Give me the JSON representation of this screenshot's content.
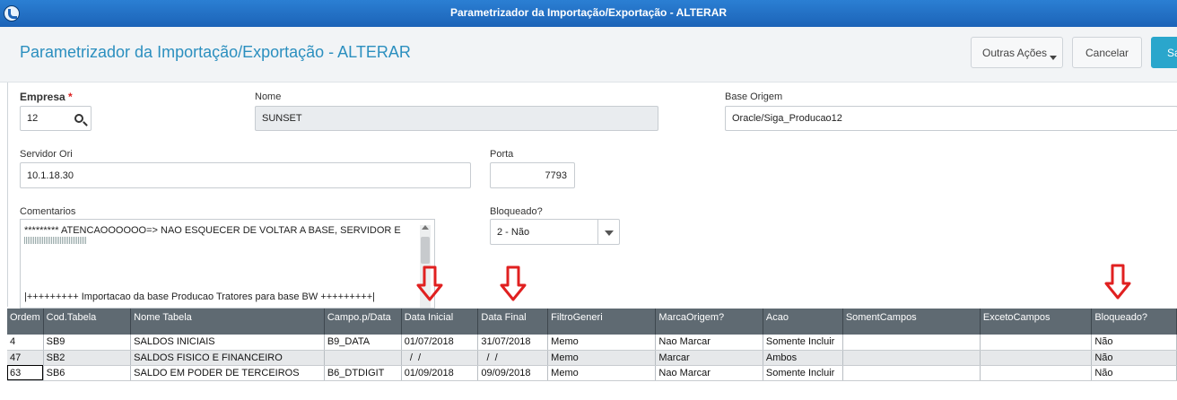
{
  "window": {
    "title": "Parametrizador da Importação/Exportação - ALTERAR"
  },
  "header": {
    "page_title": "Parametrizador da Importação/Exportação - ALTERAR",
    "outras_acoes_label": "Outras Ações",
    "cancelar_label": "Cancelar",
    "salvar_label": "Sa"
  },
  "form": {
    "empresa": {
      "label": "Empresa",
      "required_mark": "*",
      "value": "12"
    },
    "nome": {
      "label": "Nome",
      "value": "SUNSET"
    },
    "base_origem": {
      "label": "Base Origem",
      "value": "Oracle/Siga_Producao12"
    },
    "servidor_ori": {
      "label": "Servidor Ori",
      "value": "10.1.18.30"
    },
    "porta": {
      "label": "Porta",
      "value": "7793"
    },
    "comentarios": {
      "label": "Comentarios",
      "line1": "********* ATENCAOOOOOO=> NAO ESQUECER DE VOLTAR A BASE, SERVIDOR E PORTA",
      "line3": "|+++++++++  Importacao da base Producao Tratores para base BW  +++++++++|"
    },
    "bloqueado": {
      "label": "Bloqueado?",
      "value": "2 - Não"
    }
  },
  "grid": {
    "columns": [
      "Ordem",
      "Cod.Tabela",
      "Nome Tabela",
      "Campo.p/Data",
      "Data Inicial",
      "Data Final",
      "FiltroGeneri",
      "MarcaOrigem?",
      "Acao",
      "SomentCampos",
      "ExcetoCampos",
      "Bloqueado?"
    ],
    "rows": [
      [
        "4",
        "SB9",
        "SALDOS INICIAIS",
        "B9_DATA",
        "01/07/2018",
        "31/07/2018",
        "Memo",
        "Nao Marcar",
        "Somente Incluir",
        "",
        "",
        "Não"
      ],
      [
        "47",
        "SB2",
        "SALDOS FISICO E FINANCEIRO",
        "",
        "  /  /",
        "  /  /",
        "Memo",
        "Marcar",
        "Ambos",
        "",
        "",
        "Não"
      ],
      [
        "63",
        "SB6",
        "SALDO EM PODER DE TERCEIROS",
        "B6_DTDIGIT",
        "01/09/2018",
        "09/09/2018",
        "Memo",
        "Nao Marcar",
        "Somente Incluir",
        "",
        "",
        "Não"
      ]
    ]
  },
  "colors": {
    "title_bar": "#1c63b7",
    "title_text": "#2b8fbf",
    "grid_header": "#5f6a72",
    "arrow": "#e02020",
    "save_button": "#2aa6cc"
  }
}
